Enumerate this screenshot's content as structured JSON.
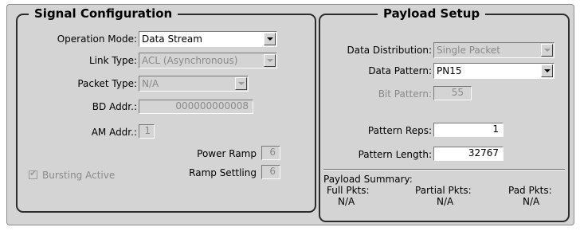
{
  "signal_config": {
    "title": "Signal Configuration",
    "operation_mode": {
      "label": "Operation Mode:",
      "value": "Data Stream"
    },
    "link_type": {
      "label": "Link Type:",
      "value": "ACL (Asynchronous)"
    },
    "packet_type": {
      "label": "Packet Type:",
      "value": "N/A"
    },
    "bd_addr": {
      "label": "BD Addr.:",
      "value": "000000000008"
    },
    "am_addr": {
      "label": "AM Addr.:",
      "value": "1"
    },
    "power_ramp": {
      "label": "Power Ramp",
      "value": "6"
    },
    "ramp_settling": {
      "label": "Ramp Settling",
      "value": "6"
    },
    "bursting_active": {
      "label": "Bursting Active",
      "checked": true
    }
  },
  "payload_setup": {
    "title": "Payload Setup",
    "data_distribution": {
      "label": "Data Distribution:",
      "value": "Single Packet"
    },
    "data_pattern": {
      "label": "Data Pattern:",
      "value": "PN15"
    },
    "bit_pattern": {
      "label": "Bit Pattern:",
      "value": "55"
    },
    "pattern_reps": {
      "label": "Pattern Reps:",
      "value": "1"
    },
    "pattern_length": {
      "label": "Pattern Length:",
      "value": "32767"
    },
    "summary": {
      "title": "Payload Summary:",
      "full_label": "Full Pkts:",
      "full_value": "N/A",
      "partial_label": "Partial Pkts:",
      "partial_value": "N/A",
      "pad_label": "Pad Pkts:",
      "pad_value": "N/A"
    }
  }
}
